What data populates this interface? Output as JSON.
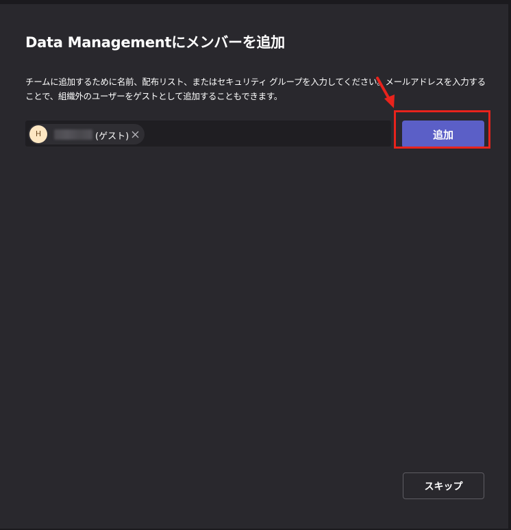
{
  "dialog": {
    "title": "Data Managementにメンバーを追加",
    "description": "チームに追加するために名前、配布リスト、またはセキュリティ グループを入力してください。メールアドレスを入力することで、組織外のユーザーをゲストとして追加することもできます。"
  },
  "people_picker": {
    "chips": [
      {
        "avatar_initial": "H",
        "suffix": "(ゲスト)",
        "remove_icon": "close-icon"
      }
    ]
  },
  "buttons": {
    "add_label": "追加",
    "skip_label": "スキップ"
  },
  "annotations": {
    "highlight_color": "#e8231c"
  },
  "colors": {
    "background": "#29282d",
    "accent": "#5b5fc7",
    "avatar_bg": "#fde7c2"
  }
}
